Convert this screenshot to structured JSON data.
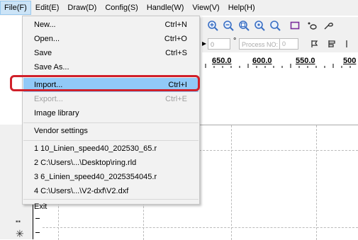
{
  "menubar": {
    "items": [
      "File(F)",
      "Edit(E)",
      "Draw(D)",
      "Config(S)",
      "Handle(W)",
      "View(V)",
      "Help(H)"
    ]
  },
  "toolbar": {
    "icons": [
      "zoom-in-icon",
      "zoom-out-icon",
      "zoom-fit-icon",
      "zoom-window-icon",
      "zoom-previous-icon",
      "rectangle-icon",
      "ellipse-tool-icon",
      "pen-icon"
    ],
    "spin_value": "0",
    "degree_symbol": "°",
    "process_no_placeholder": "Process NO:",
    "process_no_value": "0"
  },
  "ruler": {
    "labels": [
      "650.0",
      "600.0",
      "550.0",
      "500"
    ]
  },
  "file_menu": {
    "items": [
      {
        "label": "New...",
        "shortcut": "Ctrl+N",
        "disabled": false
      },
      {
        "label": "Open...",
        "shortcut": "Ctrl+O",
        "disabled": false
      },
      {
        "label": "Save",
        "shortcut": "Ctrl+S",
        "disabled": false
      },
      {
        "label": "Save As...",
        "shortcut": "",
        "disabled": false
      },
      {
        "label": "Import...",
        "shortcut": "Ctrl+I",
        "disabled": false
      },
      {
        "label": "Export...",
        "shortcut": "Ctrl+E",
        "disabled": true
      },
      {
        "label": "Image library",
        "shortcut": "",
        "disabled": false
      },
      {
        "label": "Vendor settings",
        "shortcut": "",
        "disabled": false
      },
      {
        "label": "1 10_Linien_speed40_202530_65.r",
        "shortcut": "",
        "disabled": false
      },
      {
        "label": "2 C:\\Users\\...\\Desktop\\ring.rld",
        "shortcut": "",
        "disabled": false
      },
      {
        "label": "3 6_Linien_speed40_2025354045.r",
        "shortcut": "",
        "disabled": false
      },
      {
        "label": "4 C:\\Users\\...\\V2-dxf\\V2.dxf",
        "shortcut": "",
        "disabled": false
      },
      {
        "label": "Exit",
        "shortcut": "",
        "disabled": false
      }
    ]
  },
  "colors": {
    "highlight": "#91c9f7",
    "annotation_red": "#d0202a",
    "menubar_active": "#cce4f7"
  }
}
